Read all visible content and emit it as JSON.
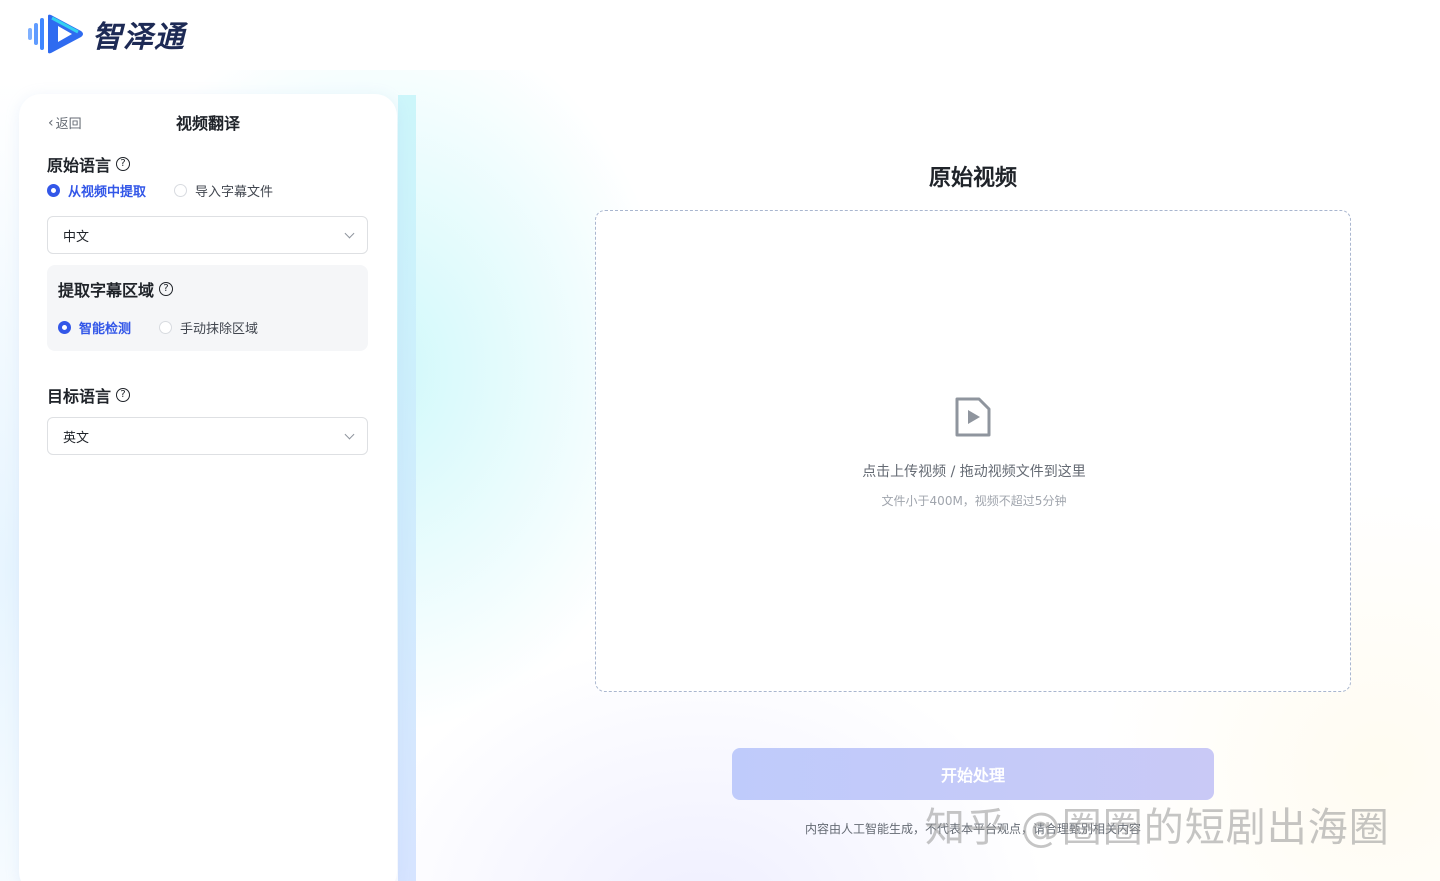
{
  "header": {
    "logo_text": "智泽通"
  },
  "panel": {
    "back_label": "返回",
    "title": "视频翻译",
    "source_language": {
      "label": "原始语言",
      "options": [
        "从视频中提取",
        "导入字幕文件"
      ],
      "selected_option": "从视频中提取",
      "select_value": "中文"
    },
    "subtitle_region": {
      "label": "提取字幕区域",
      "options": [
        "智能检测",
        "手动抹除区域"
      ],
      "selected_option": "智能检测"
    },
    "target_language": {
      "label": "目标语言",
      "select_value": "英文"
    },
    "help_symbol": "?"
  },
  "main": {
    "title": "原始视频",
    "upload": {
      "primary_text": "点击上传视频 / 拖动视频文件到这里",
      "secondary_text": "文件小于400M，视频不超过5分钟"
    },
    "start_button_label": "开始处理",
    "disclaimer": "内容由人工智能生成，不代表本平台观点，请合理甄别相关内容"
  },
  "watermark": "知乎 @圈圈的短剧出海圈",
  "colors": {
    "accent": "#3357e8",
    "start_button": "#c4cafa",
    "logo_blue": "#2f6bf0"
  }
}
